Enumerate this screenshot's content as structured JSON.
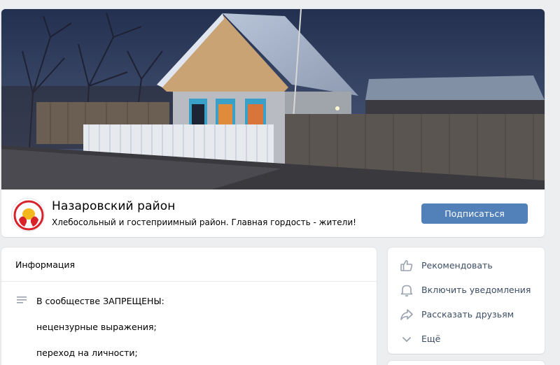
{
  "group": {
    "name": "Назаровский район",
    "status": "Хлебосольный и гостеприимный район. Главная гордость - жители!",
    "subscribe_label": "Подписаться"
  },
  "info": {
    "title": "Информация",
    "lines": [
      "В сообществе ЗАПРЕЩЕНЫ:",
      "нецензурные выражения;",
      "переход на личности;"
    ]
  },
  "actions": [
    {
      "label": "Рекомендовать",
      "icon": "thumb-up-icon"
    },
    {
      "label": "Включить уведомления",
      "icon": "bell-icon"
    },
    {
      "label": "Рассказать друзьям",
      "icon": "share-icon"
    },
    {
      "label": "Ещё",
      "icon": "chevron-down-icon"
    }
  ],
  "colors": {
    "accent": "#5181b8",
    "background": "#edeef0",
    "card": "#ffffff",
    "icon": "#99a2ad"
  }
}
